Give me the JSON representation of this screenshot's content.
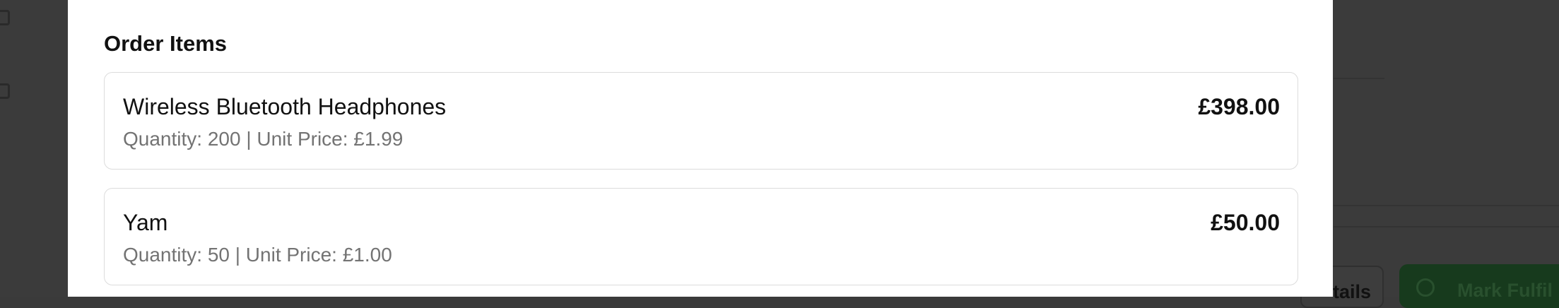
{
  "background": {
    "details_button_label": "tails",
    "fulfill_button_label": "Mark Fulfil"
  },
  "modal": {
    "section_title": "Order Items",
    "items": [
      {
        "name": "Wireless Bluetooth Headphones",
        "meta": "Quantity: 200 | Unit Price: £1.99",
        "total": "£398.00"
      },
      {
        "name": "Yam",
        "meta": "Quantity: 50 | Unit Price: £1.00",
        "total": "£50.00"
      }
    ]
  },
  "colors": {
    "overlay": "#3a3a3a",
    "modal_bg": "#ffffff",
    "card_border": "#dcdcdc",
    "muted_text": "#737373",
    "fulfill_bg": "#173a1d"
  }
}
